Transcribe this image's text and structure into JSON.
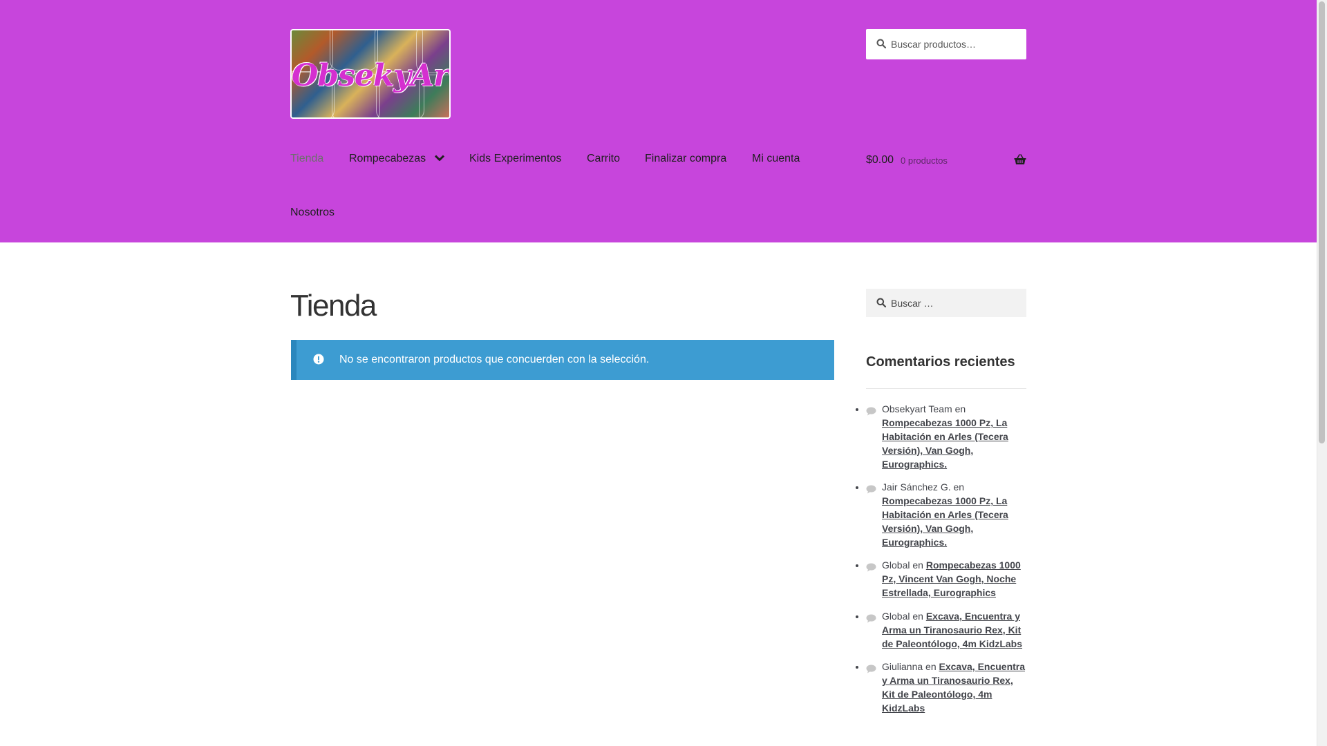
{
  "header": {
    "logo_text": "ObsekyArt",
    "search": {
      "placeholder": "Buscar productos…"
    },
    "nav": [
      {
        "label": "Tienda",
        "current": true
      },
      {
        "label": "Rompecabezas",
        "has_dropdown": true
      },
      {
        "label": "Kids Experimentos"
      },
      {
        "label": "Carrito"
      },
      {
        "label": "Finalizar compra"
      },
      {
        "label": "Mi cuenta"
      },
      {
        "label": "Nosotros"
      }
    ],
    "cart": {
      "total": "$0.00",
      "count": "0 productos"
    },
    "colors": {
      "header_bg": "#c745dc"
    }
  },
  "main": {
    "title": "Tienda",
    "notice": {
      "text": "No se encontraron productos que concuerden con la selección.",
      "color": "#3d9cd2"
    }
  },
  "sidebar": {
    "search": {
      "placeholder": "Buscar …"
    },
    "recent_comments": {
      "title": "Comentarios recientes",
      "items": [
        {
          "author": "Obsekyart Team",
          "connector": "en",
          "post": "Rompecabezas 1000 Pz, La Habitación en Arles (Tecera Versión), Van Gogh, Eurographics."
        },
        {
          "author": "Jair Sánchez G.",
          "connector": "en",
          "post": "Rompecabezas 1000 Pz, La Habitación en Arles (Tecera Versión), Van Gogh, Eurographics."
        },
        {
          "author": "Global",
          "connector": "en",
          "post": "Rompecabezas 1000 Pz, Vincent Van Gogh, Noche Estrellada, Eurographics"
        },
        {
          "author": "Global",
          "connector": "en",
          "post": "Excava, Encuentra y Arma un Tiranosaurio Rex, Kit de Paleontólogo, 4m KidzLabs"
        },
        {
          "author": "Giulianna",
          "connector": "en",
          "post": "Excava, Encuentra y Arma un Tiranosaurio Rex, Kit de Paleontólogo, 4m KidzLabs"
        }
      ]
    }
  }
}
